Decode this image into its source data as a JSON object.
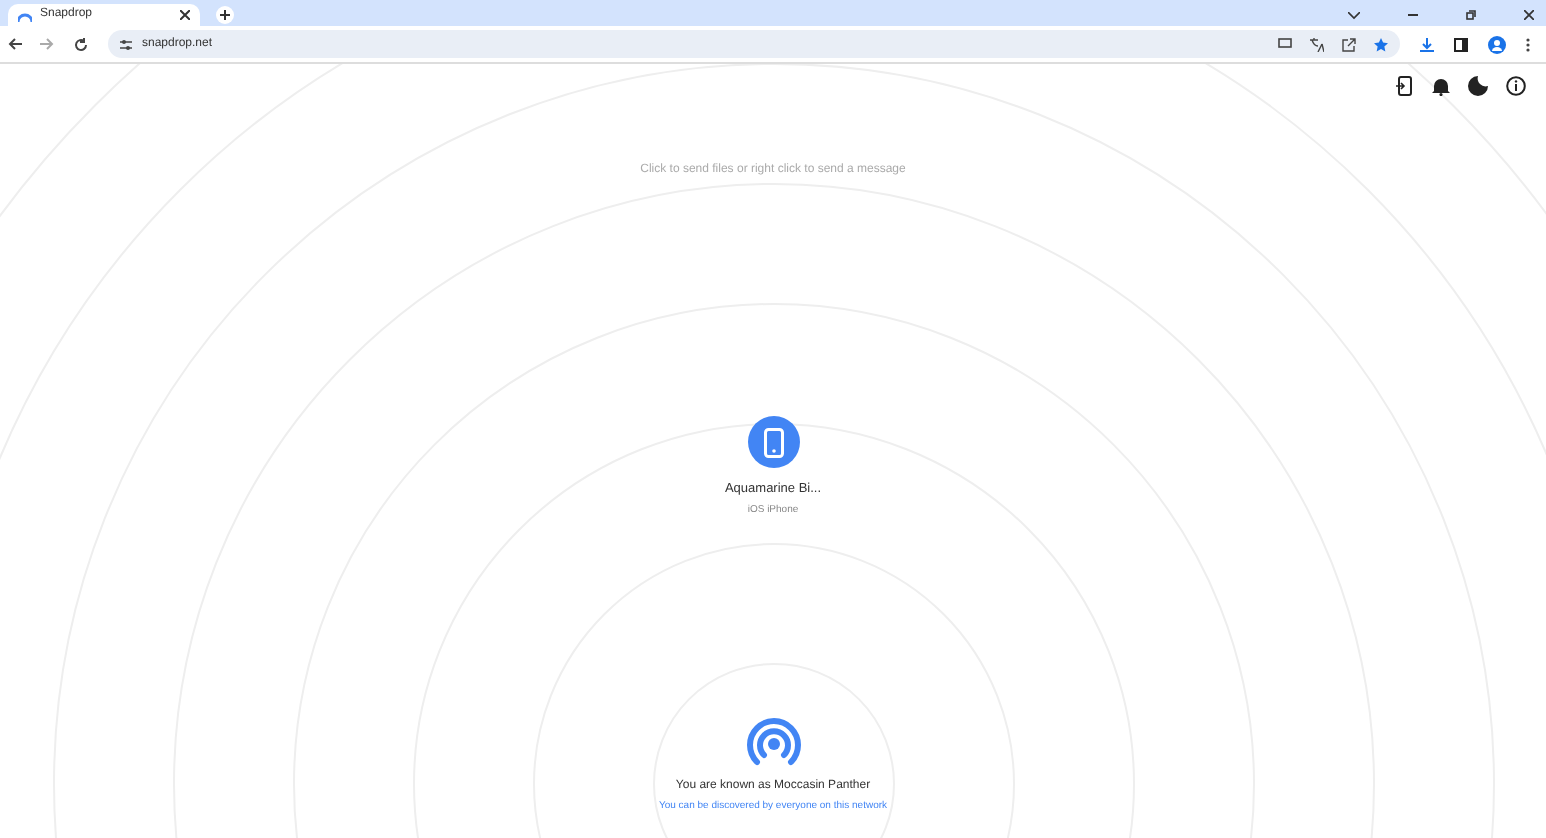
{
  "browser": {
    "tab_title": "Snapdrop",
    "url": "snapdrop.net"
  },
  "page": {
    "hint": "Click to send files or right click to send a message",
    "peers": [
      {
        "name": "Aquamarine Bi...",
        "device": "iOS iPhone"
      }
    ],
    "self": {
      "known_as": "You are known as Moccasin Panther",
      "discovery": "You can be discovered by everyone on this network"
    }
  }
}
